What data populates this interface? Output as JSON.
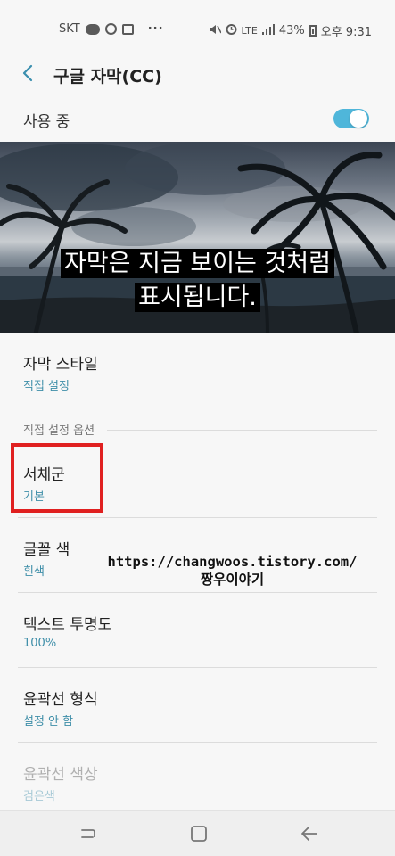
{
  "status_bar": {
    "carrier": "SKT",
    "network": "LTE",
    "battery": "43%",
    "time": "오후 9:31",
    "more": "···"
  },
  "header": {
    "title": "구글 자막(CC)",
    "back_icon": "chevron-left-icon"
  },
  "master_toggle": {
    "label": "사용 중",
    "state": "on",
    "accent_color": "#4fb6da"
  },
  "preview": {
    "caption_line1": "자막은 지금 보이는 것처럼",
    "caption_line2": "표시됩니다."
  },
  "settings": {
    "caption_style": {
      "title": "자막 스타일",
      "value": "직접 설정"
    },
    "section_header": "직접 설정 옵션",
    "font_family": {
      "title": "서체군",
      "value": "기본"
    },
    "text_color": {
      "title": "글꼴 색",
      "value": "흰색"
    },
    "text_opacity": {
      "title": "텍스트 투명도",
      "value": "100%"
    },
    "edge_type": {
      "title": "윤곽선 형식",
      "value": "설정 안 함"
    },
    "edge_color": {
      "title": "윤곽선 색상",
      "value": "검은색"
    }
  },
  "watermark": {
    "url": "https://changwoos.tistory.com/",
    "name": "짱우이야기"
  },
  "highlight_color": "#e02020",
  "nav_bar": {
    "recents_icon": "recents-icon",
    "home_icon": "home-icon",
    "back_icon": "back-arrow-icon"
  }
}
